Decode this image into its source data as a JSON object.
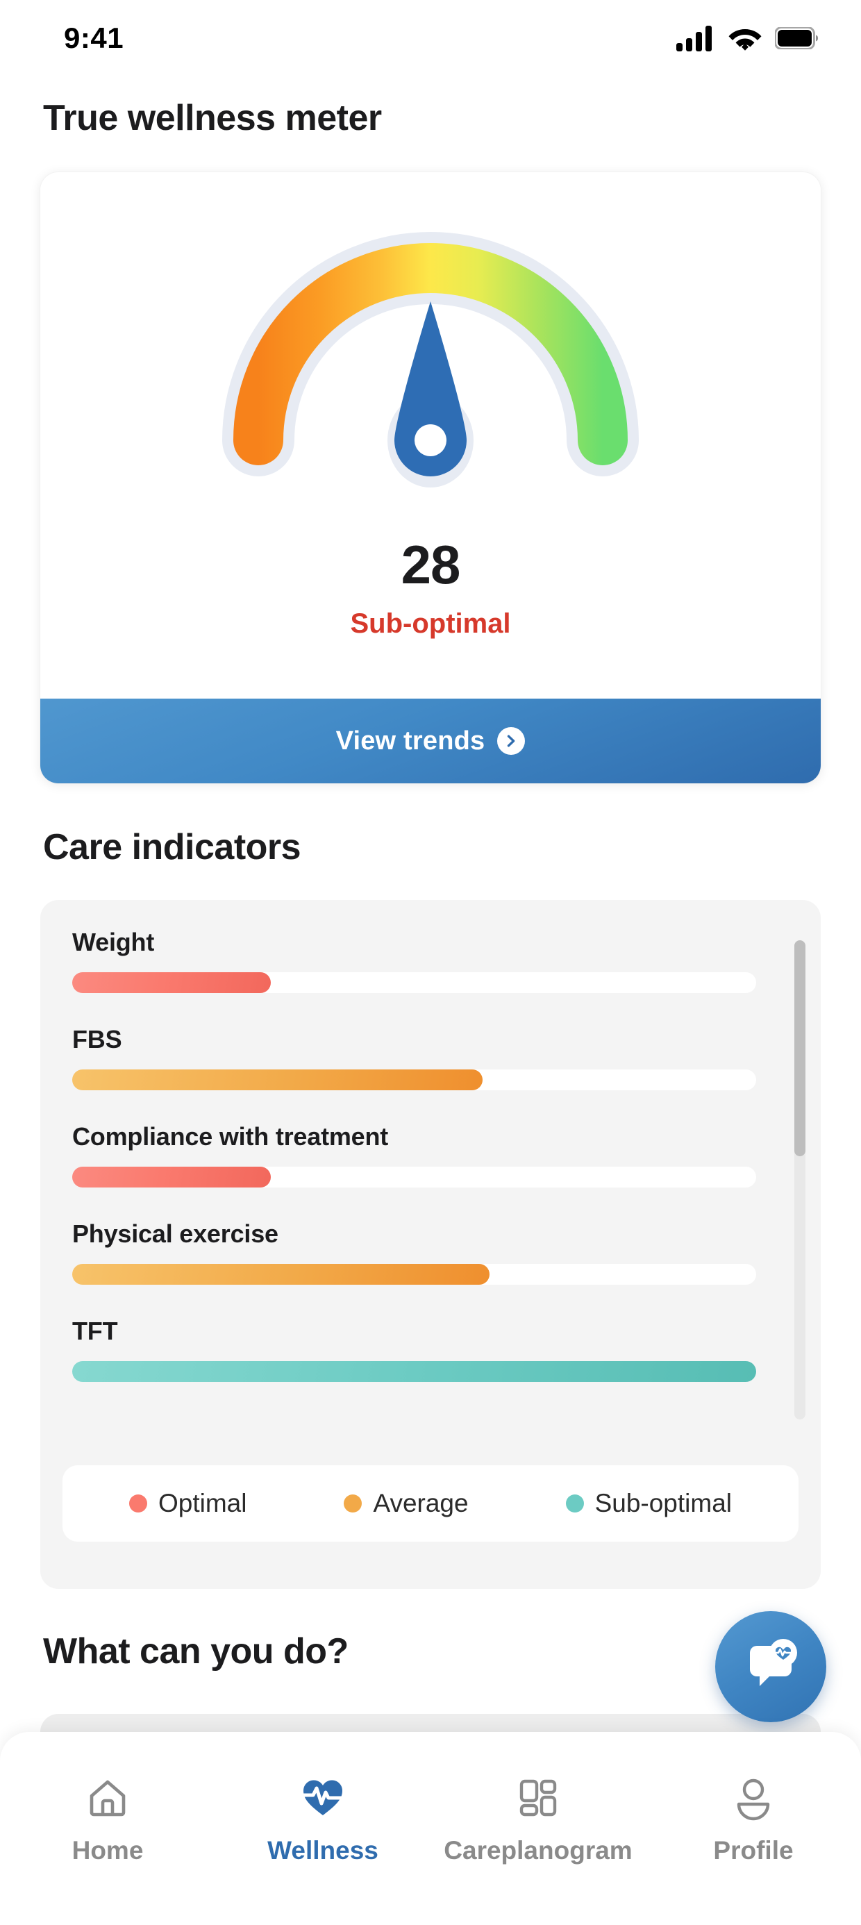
{
  "status_bar": {
    "time": "9:41",
    "icons": [
      "cellular-signal-icon",
      "wifi-icon",
      "battery-icon"
    ]
  },
  "page_title": "True wellness meter",
  "wellness": {
    "score": "28",
    "score_label": "Sub-optimal",
    "score_label_color": "#d6392b",
    "cta_label": "View trends",
    "cta_icon": "chevron-right-icon",
    "gauge": {
      "min": 0,
      "max": 100,
      "value": 28,
      "needle_color": "#2e6db4",
      "track_color": "#e6eaf2",
      "gradient_stops": [
        "#f78b1f",
        "#fbb040",
        "#fde047",
        "#cde54f",
        "#7ddc73"
      ]
    }
  },
  "care_indicators": {
    "section_title": "Care indicators",
    "items": [
      {
        "label": "Weight",
        "value": 29,
        "status": "optimal"
      },
      {
        "label": "FBS",
        "value": 60,
        "status": "average"
      },
      {
        "label": "Compliance with treatment",
        "value": 29,
        "status": "optimal"
      },
      {
        "label": "Physical exercise",
        "value": 61,
        "status": "average"
      },
      {
        "label": "TFT",
        "value": 100,
        "status": "suboptimal"
      }
    ],
    "legend": [
      {
        "label": "Optimal",
        "color": "#fa7a6e"
      },
      {
        "label": "Average",
        "color": "#f2a948"
      },
      {
        "label": "Sub-optimal",
        "color": "#6ccbc3"
      }
    ],
    "scroll_thumb_percent": 45
  },
  "what_can_you_do": {
    "title": "What can you do?"
  },
  "fab": {
    "icon": "chat-health-icon",
    "color": "#3f85c3"
  },
  "bottom_nav": {
    "items": [
      {
        "label": "Home",
        "icon": "home-icon",
        "active": false
      },
      {
        "label": "Wellness",
        "icon": "heart-pulse-icon",
        "active": true
      },
      {
        "label": "Careplanogram",
        "icon": "grid-dashboard-icon",
        "active": false
      },
      {
        "label": "Profile",
        "icon": "person-icon",
        "active": false
      }
    ],
    "active_color": "#2f6cae",
    "inactive_color": "#8a8a8a"
  },
  "chart_data": {
    "type": "bar",
    "title": "Care indicators",
    "categories": [
      "Weight",
      "FBS",
      "Compliance with treatment",
      "Physical exercise",
      "TFT"
    ],
    "values": [
      29,
      60,
      29,
      61,
      100
    ],
    "statuses": [
      "optimal",
      "average",
      "optimal",
      "average",
      "suboptimal"
    ],
    "xlabel": "",
    "ylabel": "",
    "ylim": [
      0,
      100
    ],
    "legend": [
      "Optimal",
      "Average",
      "Sub-optimal"
    ],
    "legend_position": "bottom",
    "grid": false,
    "gauge": {
      "type": "gauge",
      "title": "True wellness meter",
      "value": 28,
      "range": [
        0,
        100
      ],
      "status": "Sub-optimal"
    }
  }
}
